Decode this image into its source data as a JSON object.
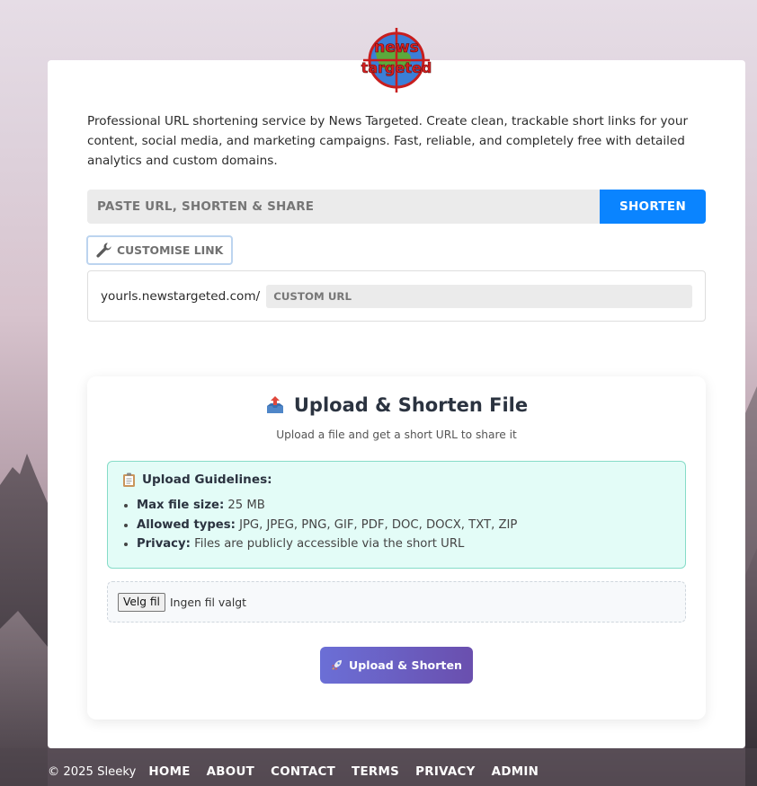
{
  "brand": {
    "logo_text_top": "news",
    "logo_text_bottom": "targeted"
  },
  "intro": {
    "text": "Professional URL shortening service by News Targeted. Create clean, trackable short links for your content, social media, and marketing campaigns. Fast, reliable, and completely free with detailed analytics and custom domains."
  },
  "shortener": {
    "placeholder": "PASTE URL, SHORTEN & SHARE",
    "button_label": "SHORTEN",
    "accent": "#0a84ff"
  },
  "customise": {
    "button_label": "CUSTOMISE LINK",
    "icon": "wrench-icon",
    "prefix": "yourls.newstargeted.com/",
    "placeholder": "CUSTOM URL"
  },
  "upload": {
    "title": "Upload & Shorten File",
    "subtitle": "Upload a file and get a short URL to share it",
    "guidelines_title": "Upload Guidelines:",
    "guidelines": [
      {
        "label": "Max file size:",
        "value": "25 MB"
      },
      {
        "label": "Allowed types:",
        "value": "JPG, JPEG, PNG, GIF, PDF, DOC, DOCX, TXT, ZIP"
      },
      {
        "label": "Privacy:",
        "value": "Files are publicly accessible via the short URL"
      }
    ],
    "file_button": "Velg fil",
    "file_status": "Ingen fil valgt",
    "submit_label": "Upload & Shorten"
  },
  "footer": {
    "copyright": "© 2025 Sleeky",
    "links": [
      "HOME",
      "ABOUT",
      "CONTACT",
      "TERMS",
      "PRIVACY",
      "ADMIN"
    ]
  }
}
